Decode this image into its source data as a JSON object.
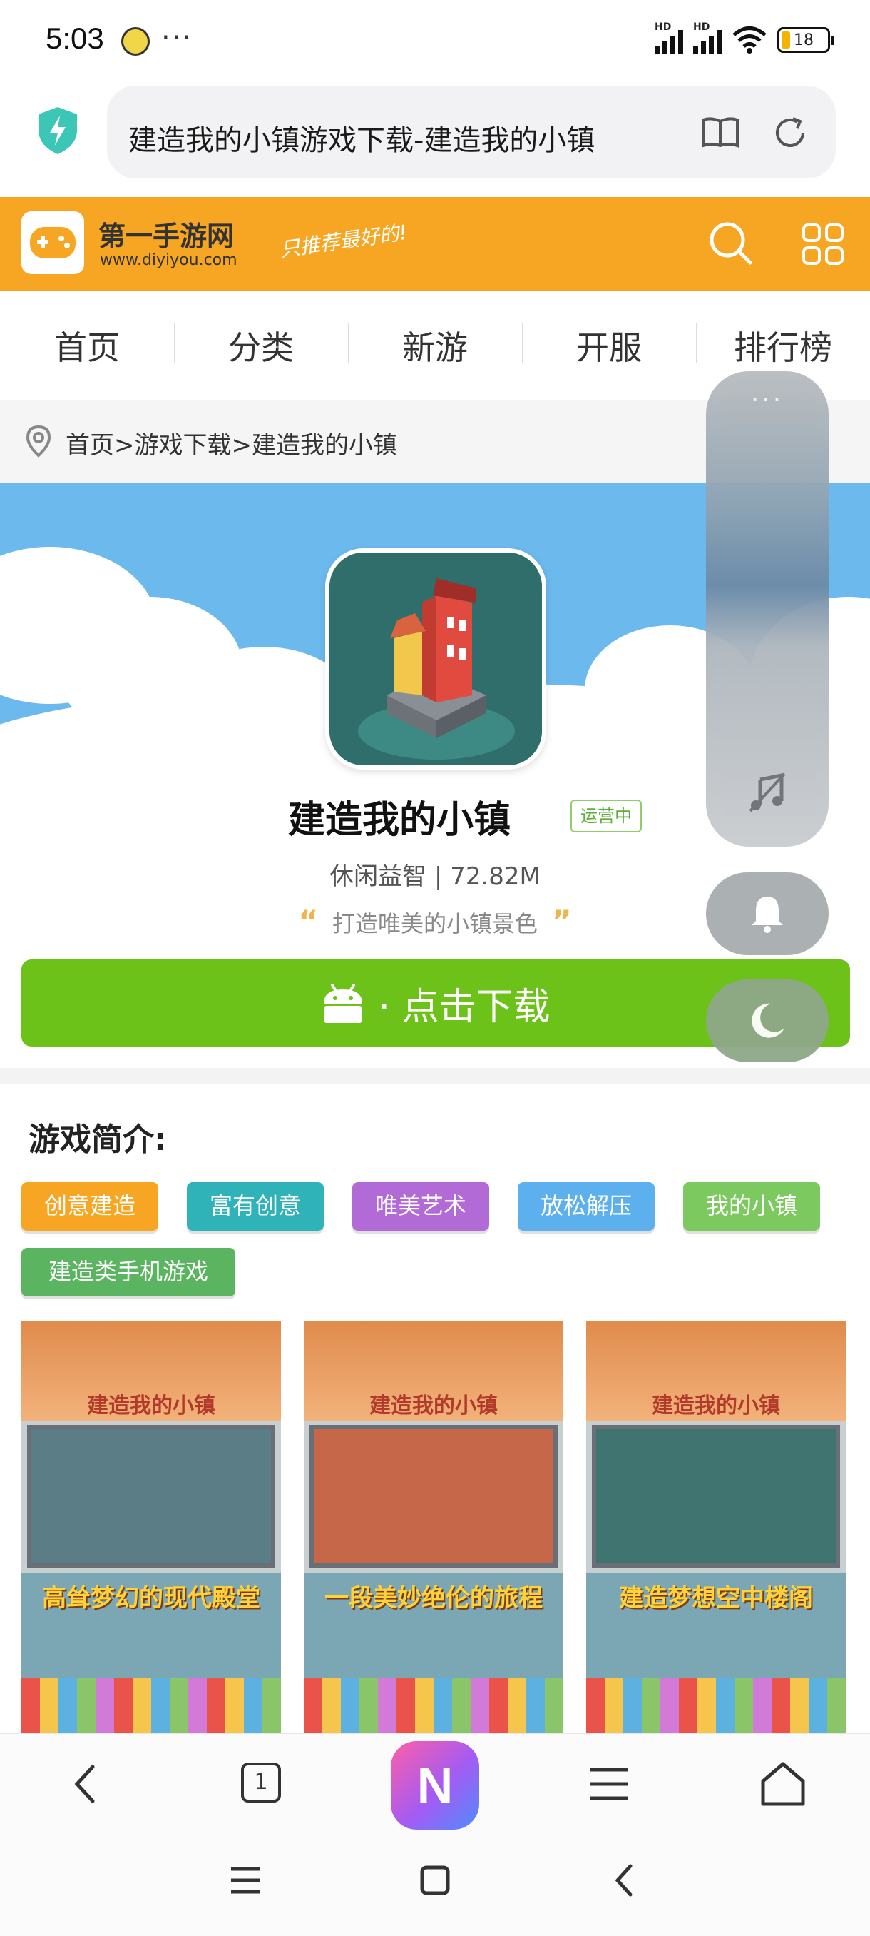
{
  "status_bar": {
    "time": "5:03",
    "dots": "···",
    "network_1": "HD",
    "network_2": "HD",
    "battery": "18"
  },
  "browser": {
    "url_title": "建造我的小镇游戏下载-建造我的小镇"
  },
  "site": {
    "name": "第一手游网",
    "domain": "www.diyiyou.com",
    "slogan": "只推荐最好的!",
    "brand_color": "#f7a623"
  },
  "nav": {
    "items": [
      "首页",
      "分类",
      "新游",
      "开服",
      "排行榜"
    ]
  },
  "breadcrumb": {
    "text": "首页>游戏下载>建造我的小镇"
  },
  "game": {
    "title": "建造我的小镇",
    "status": "运营中",
    "meta": "休闲益智 | 72.82M",
    "quote": "打造唯美的小镇景色",
    "quote_open": "“",
    "quote_close": "”",
    "download_label": "· 点击下载",
    "download_color": "#6cc218"
  },
  "intro": {
    "title": "游戏简介:",
    "tags": [
      {
        "label": "创意建造",
        "color": "#f7a623"
      },
      {
        "label": "富有创意",
        "color": "#2fb3b8"
      },
      {
        "label": "唯美艺术",
        "color": "#b26bd6"
      },
      {
        "label": "放松解压",
        "color": "#5cb0ee"
      },
      {
        "label": "我的小镇",
        "color": "#7cc95f"
      },
      {
        "label": "建造类手机游戏",
        "color": "#5bb560"
      }
    ]
  },
  "screenshots": [
    {
      "logo": "建造我的小镇",
      "caption": "高耸梦幻的现代殿堂"
    },
    {
      "logo": "建造我的小镇",
      "caption": "一段美妙绝伦的旅程"
    },
    {
      "logo": "建造我的小镇",
      "caption": "建造梦想空中楼阁"
    }
  ],
  "float_panel": {
    "dots": "···"
  },
  "bottom_bar": {
    "tab_count": "1",
    "ai_label": "N"
  }
}
